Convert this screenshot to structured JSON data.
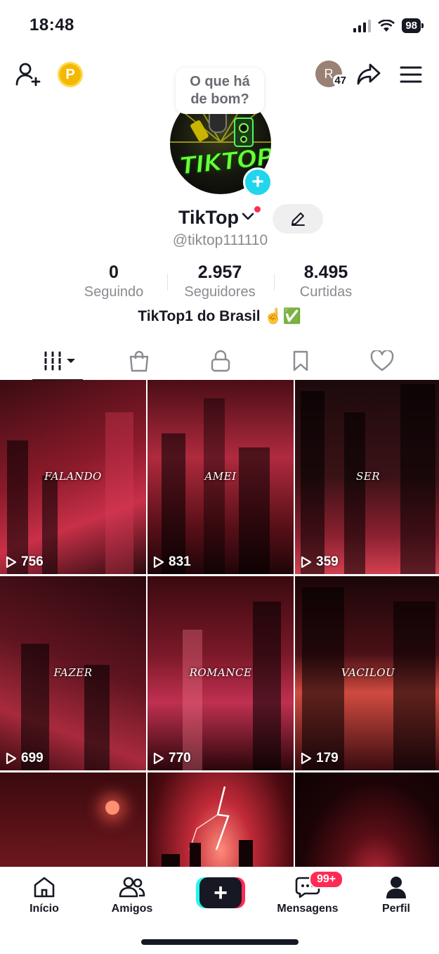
{
  "status_bar": {
    "time": "18:48",
    "battery": "98"
  },
  "top_nav": {
    "coin_letter": "P",
    "visitor_initial": "R",
    "visitor_count": "47",
    "bubble_line1": "O que há",
    "bubble_line2": "de bom?"
  },
  "profile": {
    "avatar_text": "TIKTOP",
    "display_name": "TikTop",
    "username": "@tiktop111110",
    "bio": "TikTop1 do Brasil ☝️✅"
  },
  "stats": [
    {
      "value": "0",
      "label": "Seguindo"
    },
    {
      "value": "2.957",
      "label": "Seguidores"
    },
    {
      "value": "8.495",
      "label": "Curtidas"
    }
  ],
  "tabs": [
    {
      "icon": "grid-icon",
      "active": true
    },
    {
      "icon": "shopping-bag-icon",
      "active": false
    },
    {
      "icon": "lock-icon",
      "active": false
    },
    {
      "icon": "bookmark-icon",
      "active": false
    },
    {
      "icon": "heart-icon",
      "active": false
    }
  ],
  "videos": [
    {
      "word": "FALANDO",
      "views": "756"
    },
    {
      "word": "AMEI",
      "views": "831"
    },
    {
      "word": "SER",
      "views": "359"
    },
    {
      "word": "FAZER",
      "views": "699"
    },
    {
      "word": "ROMANCE",
      "views": "770"
    },
    {
      "word": "VACILOU",
      "views": "179"
    },
    {
      "word": "",
      "views": ""
    },
    {
      "word": "",
      "views": ""
    },
    {
      "word": "",
      "views": ""
    }
  ],
  "bottom_nav": {
    "home": "Início",
    "friends": "Amigos",
    "messages": "Mensagens",
    "messages_badge": "99+",
    "profile": "Perfil"
  },
  "colors": {
    "accent_red": "#fe2c55",
    "accent_cyan": "#25f4ee",
    "text": "#161823",
    "muted": "#8a8b91"
  }
}
